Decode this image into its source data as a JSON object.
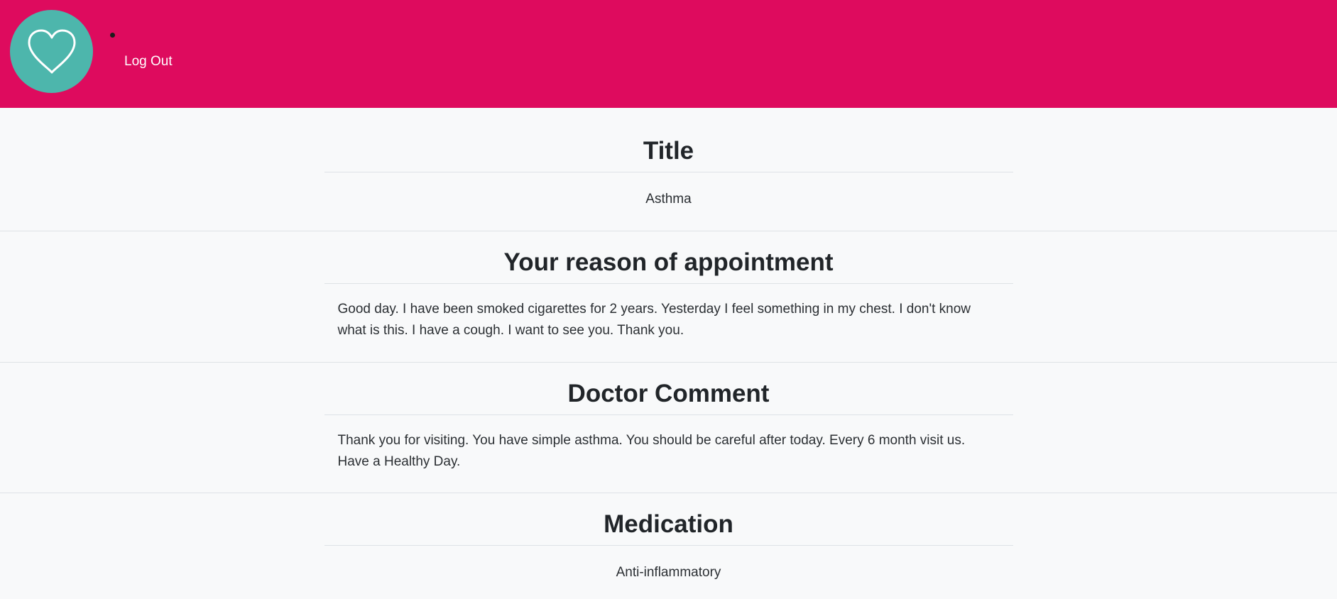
{
  "header": {
    "logo_icon": "heart-icon",
    "background_color": "#de0b5e",
    "logo_color": "#4db6ac",
    "nav": {
      "logout_label": "Log Out"
    }
  },
  "sections": {
    "title": {
      "heading": "Title",
      "value": "Asthma"
    },
    "reason": {
      "heading": "Your reason of appointment",
      "value": "Good day. I have been smoked cigarettes for 2 years. Yesterday I feel something in my chest. I don't know what is this. I have a cough. I want to see you. Thank you."
    },
    "doctor_comment": {
      "heading": "Doctor Comment",
      "value": "Thank you for visiting. You have simple asthma. You should be careful after today. Every 6 month visit us. Have a Healthy Day."
    },
    "medication": {
      "heading": "Medication",
      "value": "Anti-inflammatory"
    }
  }
}
